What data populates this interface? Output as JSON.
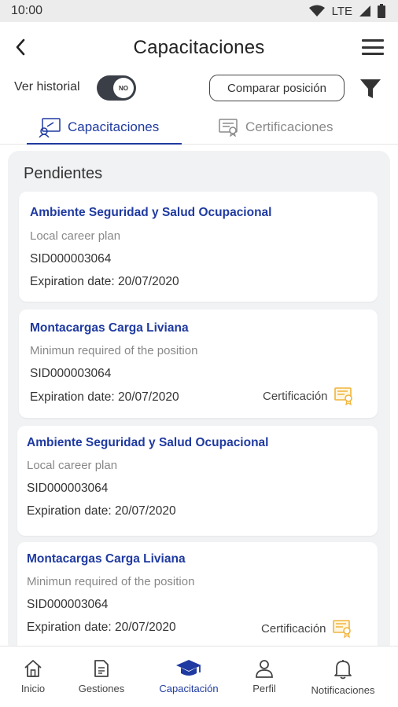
{
  "status_bar": {
    "time": "10:00",
    "network": "LTE"
  },
  "header": {
    "title": "Capacitaciones",
    "back_icon": "arrow-back-icon",
    "menu_icon": "hamburger-menu-icon"
  },
  "controls": {
    "history_label": "Ver historial",
    "history_toggle": "NO",
    "compare_label": "Comparar posición",
    "filter_icon": "filter-icon"
  },
  "tabs": [
    {
      "label": "Capacitaciones",
      "active": true
    },
    {
      "label": "Certificaciones",
      "active": false
    }
  ],
  "section": {
    "title": "Pendientes"
  },
  "cards": [
    {
      "title": "Ambiente Seguridad y Salud Ocupacional",
      "subtitle": "Local career plan",
      "id": "SID000003064",
      "expiration": "Expiration date: 20/07/2020",
      "certification": ""
    },
    {
      "title": "Montacargas Carga Liviana",
      "subtitle": "Minimun required of the position",
      "id": "SID000003064",
      "expiration": "Expiration date: 20/07/2020",
      "certification": "Certificación"
    },
    {
      "title": "Ambiente Seguridad y Salud Ocupacional",
      "subtitle": "Local career plan",
      "id": "SID000003064",
      "expiration": "Expiration date: 20/07/2020",
      "certification": ""
    },
    {
      "title": "Montacargas Carga Liviana",
      "subtitle": "Minimun required of the position",
      "id": "SID000003064",
      "expiration": "Expiration date: 20/07/2020",
      "certification": "Certificación"
    }
  ],
  "bottom_nav": [
    {
      "label": "Inicio",
      "icon": "home-icon",
      "active": false
    },
    {
      "label": "Gestiones",
      "icon": "document-icon",
      "active": false
    },
    {
      "label": "Capacitación",
      "icon": "graduation-cap-icon",
      "active": true
    },
    {
      "label": "Perfil",
      "icon": "person-icon",
      "active": false
    },
    {
      "label": "Notificaciones",
      "icon": "bell-icon",
      "active": false
    }
  ],
  "colors": {
    "accent": "#1f3aa0",
    "cert_icon": "#f0b43a",
    "panel_bg": "#f1f2f4"
  }
}
